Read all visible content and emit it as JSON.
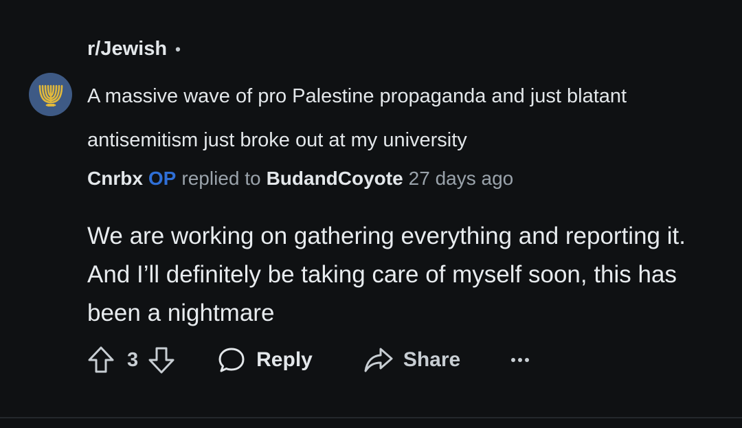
{
  "post": {
    "subreddit": "r/Jewish",
    "separator": "•",
    "title": "A massive wave of pro Palestine propaganda and just blatant antisemitism just broke out at my university",
    "avatar_icon": "menorah-icon"
  },
  "comment": {
    "author": "Cnrbx",
    "op_badge": "OP",
    "replied_text": "replied to",
    "parent_author": "BudandCoyote",
    "age": "27 days ago",
    "body_lines": [
      "We are working on gathering everything and reporting it.",
      "And I’ll definitely be taking care of myself soon, this has",
      "been a nightmare"
    ]
  },
  "actions": {
    "vote_count": "3",
    "reply_label": "Reply",
    "share_label": "Share",
    "more_icon": "more-horizontal-icon"
  },
  "colors": {
    "background": "#0f1113",
    "avatar": "#3e5a85",
    "menorah": "#e2b93b",
    "op_badge": "#2f6fd6",
    "muted_text": "#9aa3ab"
  }
}
